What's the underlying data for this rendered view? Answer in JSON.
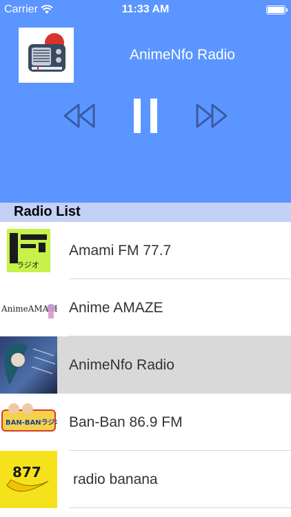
{
  "status_bar": {
    "carrier": "Carrier",
    "time": "11:33 AM"
  },
  "player": {
    "station_name": "AnimeNfo Radio",
    "controls": {
      "rewind": "rewind-icon",
      "pause": "pause-icon",
      "fast_forward": "fast-forward-icon"
    }
  },
  "section_header": "Radio List",
  "stations": [
    {
      "name": "Amami FM 77.7",
      "thumb_text": "ラジオ"
    },
    {
      "name": "Anime AMAZE",
      "thumb_text": "AnimeAMAZE"
    },
    {
      "name": "AnimeNfo Radio",
      "selected": true
    },
    {
      "name": "Ban-Ban 86.9 FM",
      "thumb_text": "BAN-BANラジオ"
    },
    {
      "name": "radio banana",
      "thumb_text": "877"
    }
  ],
  "colors": {
    "player_bg": "#5b95ff",
    "header_bg": "#c3d1f7",
    "selected_row": "#d9d9d9",
    "control_stroke": "#3a5aa0"
  }
}
